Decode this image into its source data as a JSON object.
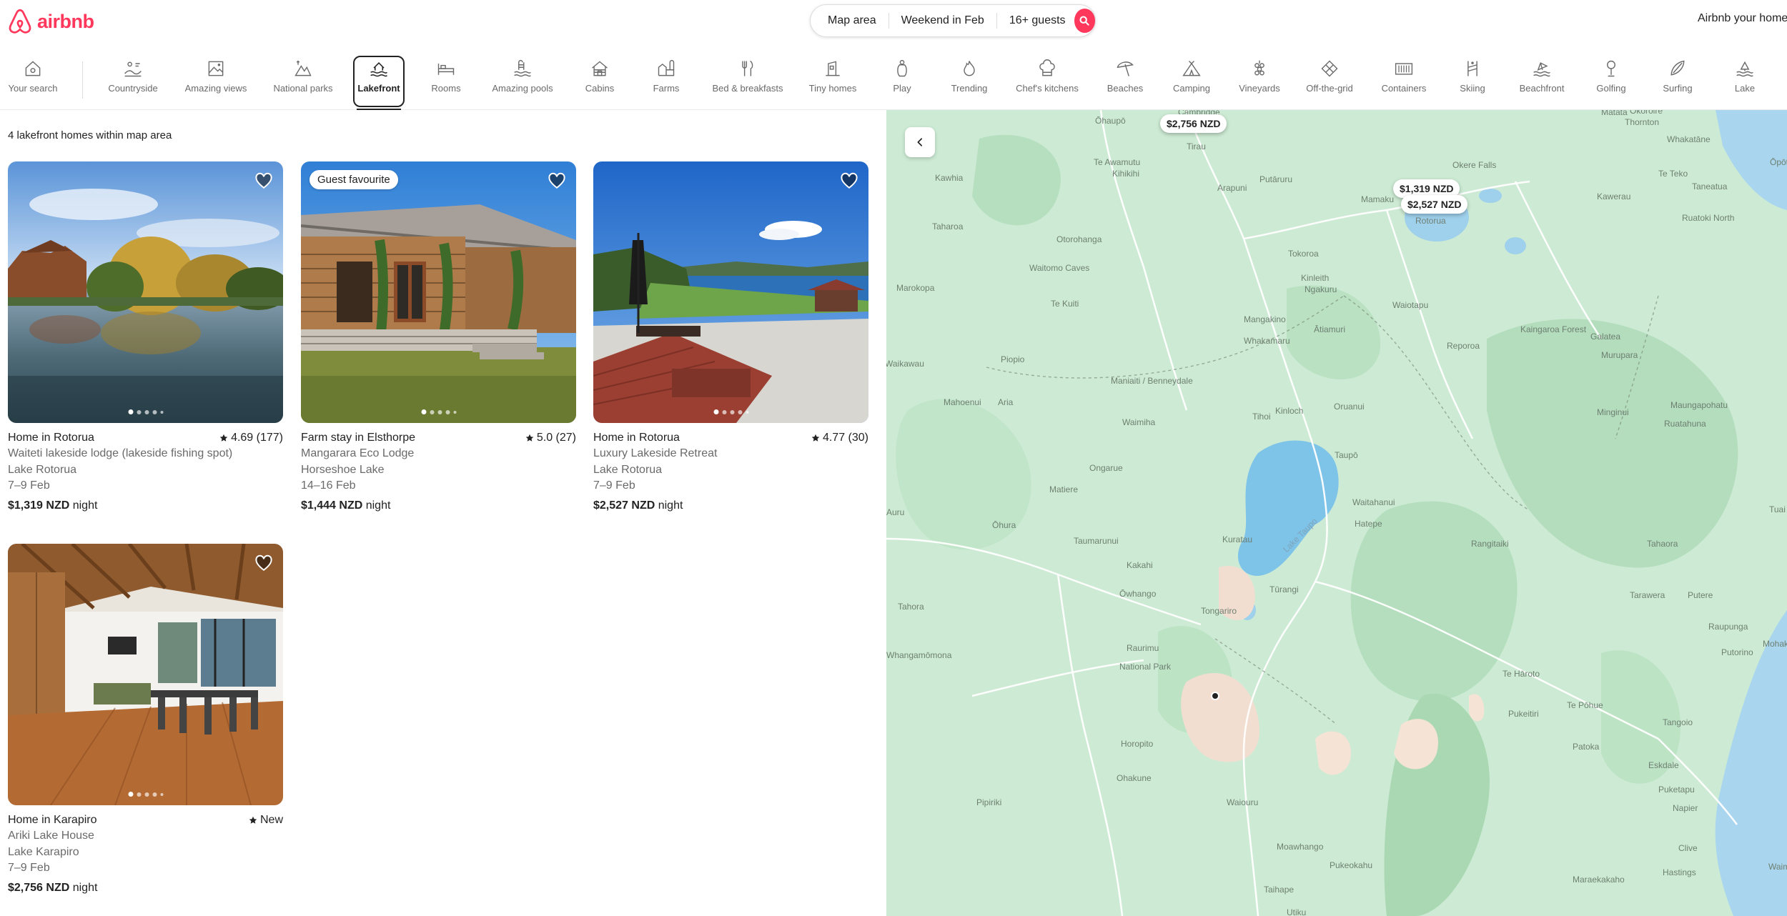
{
  "header": {
    "logo_text": "airbnb",
    "search": {
      "where": "Map area",
      "when": "Weekend in Feb",
      "who": "16+ guests"
    },
    "host_link": "Airbnb your home",
    "brand_color": "#ff385c"
  },
  "categories": [
    {
      "label": "Your search",
      "icon": "search-home-icon"
    },
    {
      "label": "Countryside",
      "icon": "countryside-icon"
    },
    {
      "label": "Amazing views",
      "icon": "amazing-views-icon"
    },
    {
      "label": "National parks",
      "icon": "national-parks-icon"
    },
    {
      "label": "Lakefront",
      "icon": "lakefront-icon",
      "active": true
    },
    {
      "label": "Rooms",
      "icon": "rooms-icon"
    },
    {
      "label": "Amazing pools",
      "icon": "pool-icon"
    },
    {
      "label": "Cabins",
      "icon": "cabin-icon"
    },
    {
      "label": "Farms",
      "icon": "farm-icon"
    },
    {
      "label": "Bed & breakfasts",
      "icon": "bed-breakfast-icon"
    },
    {
      "label": "Tiny homes",
      "icon": "tiny-home-icon"
    },
    {
      "label": "Play",
      "icon": "play-icon"
    },
    {
      "label": "Trending",
      "icon": "trending-icon"
    },
    {
      "label": "Chef's kitchens",
      "icon": "chef-hat-icon"
    },
    {
      "label": "Beaches",
      "icon": "beach-umbrella-icon"
    },
    {
      "label": "Camping",
      "icon": "camping-icon"
    },
    {
      "label": "Vineyards",
      "icon": "vineyard-icon"
    },
    {
      "label": "Off-the-grid",
      "icon": "off-grid-icon"
    },
    {
      "label": "Containers",
      "icon": "container-icon"
    },
    {
      "label": "Skiing",
      "icon": "skiing-icon"
    },
    {
      "label": "Beachfront",
      "icon": "beachfront-icon"
    },
    {
      "label": "Golfing",
      "icon": "golf-icon"
    },
    {
      "label": "Surfing",
      "icon": "surfing-icon"
    },
    {
      "label": "Lake",
      "icon": "lake-icon"
    }
  ],
  "results": {
    "count_text": "4 lakefront homes within map area"
  },
  "listings": [
    {
      "title": "Home in Rotorua",
      "rating": "4.69 (177)",
      "name": "Waiteti lakeside lodge (lakeside fishing spot)",
      "location": "Lake Rotorua",
      "dates": "7–9 Feb",
      "price": "$1,319 NZD",
      "price_suffix": " night",
      "badge": ""
    },
    {
      "title": "Farm stay in Elsthorpe",
      "rating": "5.0 (27)",
      "name": "Mangarara Eco Lodge",
      "location": "Horseshoe Lake",
      "dates": "14–16 Feb",
      "price": "$1,444 NZD",
      "price_suffix": " night",
      "badge": "Guest favourite"
    },
    {
      "title": "Home in Rotorua",
      "rating": "4.77 (30)",
      "name": "Luxury Lakeside Retreat",
      "location": "Lake Rotorua",
      "dates": "7–9 Feb",
      "price": "$2,527 NZD",
      "price_suffix": " night",
      "badge": ""
    },
    {
      "title": "Home in Karapiro",
      "rating": "New",
      "name": "Ariki Lake House",
      "location": "Lake Karapiro",
      "dates": "7–9 Feb",
      "price": "$2,756 NZD",
      "price_suffix": " night",
      "badge": ""
    }
  ],
  "map": {
    "price_pins": [
      "$2,756 NZD",
      "$1,319 NZD",
      "$2,527 NZD"
    ],
    "lake_label": "Lake Taupo",
    "places": [
      "Ōhaupō",
      "Cambridge",
      "Tirau",
      "Okoroire",
      "Te Awamutu",
      "Kihikihi",
      "Putāruru",
      "Arapuni",
      "Kawhia",
      "Mamaku",
      "Okere Falls",
      "Rotorua",
      "Thornton",
      "Whakatāne",
      "Matata",
      "Taharoa",
      "Te Teko",
      "Kawerau",
      "Taneatua",
      "Ruatoki North",
      "Ōpōtiki",
      "Otorohanga",
      "Tokoroa",
      "Waitomo Caves",
      "Kinleith",
      "Ngakuru",
      "Te Kuiti",
      "Marokopa",
      "Mangakino",
      "Waiotapu",
      "Whakamaru",
      "Ātiamuri",
      "Kaingaroa Forest",
      "Galatea",
      "Reporoa",
      "Piopio",
      "Murupara",
      "Aria",
      "Waikawau",
      "Maniaiti / Benneydale",
      "Mahoenui",
      "Oruanui",
      "Maungapohatu",
      "Minginui",
      "Waimiha",
      "Tihoi",
      "Ruatahuna",
      "Kinloch",
      "Taupō",
      "Ongarue",
      "Matiere",
      "Waitahanui",
      "Hatepe",
      "Ōhura",
      "Taumarunui",
      "Kuratau",
      "Tūrangi",
      "Rangitaiki",
      "Tahaora",
      "Tuai",
      "Kakahi",
      "Tahora",
      "Ōwhango",
      "Tongariro",
      "Te Hāroto",
      "Tarawera",
      "Putere",
      "Raurimu",
      "Raupunga",
      "Mohaka",
      "Whangamōmona",
      "National Park",
      "Putorino",
      "Horopito",
      "Te Pōhue",
      "Pukeitiri",
      "Patoka",
      "Tangoio",
      "Ohakune",
      "Eskdale",
      "Puketapu",
      "Pipiriki",
      "Waiouru",
      "Napier",
      "Moawhango",
      "Clive",
      "Pukeokahu",
      "Hastings",
      "Maraekakaho",
      "Taihape",
      "Utiku",
      "Waimarino",
      "Auru"
    ]
  },
  "colors": {
    "map_land": "#cdebd4",
    "map_sea": "#a9d6ee",
    "map_lake": "#7ec3e8",
    "map_mountain": "#f2ded0"
  }
}
